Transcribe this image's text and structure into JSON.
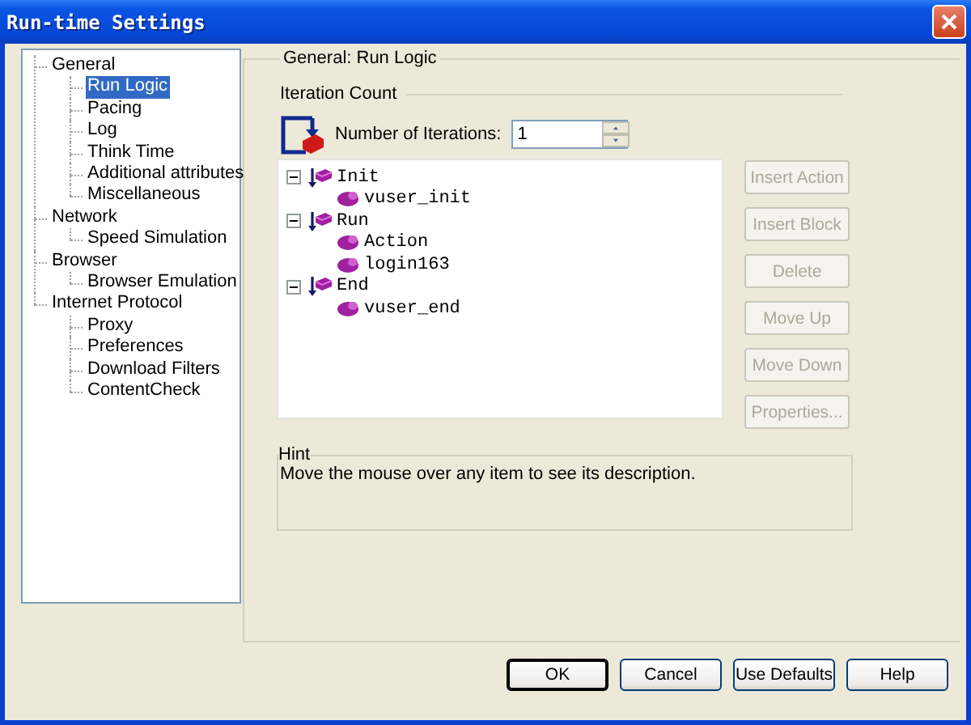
{
  "window": {
    "title": "Run-time Settings"
  },
  "sidebar": {
    "items": [
      {
        "label": "General",
        "selected": false,
        "children": [
          {
            "label": "Run Logic",
            "selected": true
          },
          {
            "label": "Pacing",
            "selected": false
          },
          {
            "label": "Log",
            "selected": false
          },
          {
            "label": "Think Time",
            "selected": false
          },
          {
            "label": "Additional attributes",
            "selected": false
          },
          {
            "label": "Miscellaneous",
            "selected": false
          }
        ]
      },
      {
        "label": "Network",
        "selected": false,
        "children": [
          {
            "label": "Speed Simulation",
            "selected": false
          }
        ]
      },
      {
        "label": "Browser",
        "selected": false,
        "children": [
          {
            "label": "Browser Emulation",
            "selected": false
          }
        ]
      },
      {
        "label": "Internet Protocol",
        "selected": false,
        "children": [
          {
            "label": "Proxy",
            "selected": false
          },
          {
            "label": "Preferences",
            "selected": false
          },
          {
            "label": "Download Filters",
            "selected": false
          },
          {
            "label": "ContentCheck",
            "selected": false
          }
        ]
      }
    ]
  },
  "panel": {
    "title": "General: Run Logic",
    "iteration_count": {
      "title": "Iteration Count",
      "label": "Number of Iterations:",
      "value": "1"
    },
    "run_tree": [
      {
        "kind": "block",
        "label": "Init",
        "expanded": true,
        "children": [
          {
            "kind": "action",
            "label": "vuser_init"
          }
        ]
      },
      {
        "kind": "block",
        "label": "Run",
        "expanded": true,
        "children": [
          {
            "kind": "action",
            "label": "Action"
          },
          {
            "kind": "action",
            "label": "login163"
          }
        ]
      },
      {
        "kind": "block",
        "label": "End",
        "expanded": true,
        "children": [
          {
            "kind": "action",
            "label": "vuser_end"
          }
        ]
      }
    ],
    "actions": [
      {
        "label": "Insert Action",
        "disabled": true
      },
      {
        "label": "Insert Block",
        "disabled": true
      },
      {
        "label": "Delete",
        "disabled": true
      },
      {
        "label": "Move Up",
        "disabled": true
      },
      {
        "label": "Move Down",
        "disabled": true
      },
      {
        "label": "Properties...",
        "disabled": true
      }
    ],
    "hint": {
      "title": "Hint",
      "text": "Move the mouse over any item to see its description."
    }
  },
  "buttons": [
    {
      "label": "OK",
      "default": true
    },
    {
      "label": "Cancel",
      "default": false
    },
    {
      "label": "Use Defaults",
      "default": false
    },
    {
      "label": "Help",
      "default": false
    }
  ]
}
